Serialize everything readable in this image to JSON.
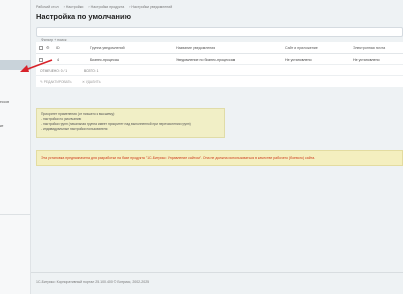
{
  "sidebar": {
    "items": [
      "ессов",
      "ке"
    ]
  },
  "breadcrumb": [
    "Рабочий стол",
    "Настройки",
    "Настройки продукта",
    "Настройки уведомлений"
  ],
  "page_title": "Настройка по умолчанию",
  "search": {
    "placeholder": "Фильтр + поиск"
  },
  "grid": {
    "columns": [
      "ID",
      "Группа уведомлений",
      "Название уведомления",
      "Сайт и приложение",
      "Электронная почта"
    ],
    "rows": [
      {
        "id": "4",
        "group": "Бизнес-процессы",
        "name": "Уведомление по бизнес-процессам",
        "site": "Не установлено",
        "email": "Не установлено"
      }
    ],
    "footer": {
      "selected": "ОТМЕЧЕНО: 0 / 1",
      "total": "ВСЕГО: 1"
    },
    "actions": {
      "edit": "РЕДАКТИРОВАТЬ",
      "delete": "УДАЛИТЬ"
    }
  },
  "info": {
    "lines": [
      "Приоритет применения (от низшего к высшему):",
      "- настройки по умолчанию",
      "- настройки групп (начальная группа имеет приоритет над выполненной при перечислении групп)",
      "- индивидуальные настройки пользователя"
    ]
  },
  "warning": "Эта установка предназначена для разработки на базе продукта \"1С-Битрикс: Управление сайтом\". Она не должна использоваться в качестве рабочего (боевого) сайта.",
  "footer": {
    "copyright": "1С-Битрикс: Корпоративный портал 25.100.400 © Битрикс, 2002-2025"
  },
  "colors": {
    "background": "#eef2f4",
    "info": "#f1efc6",
    "warning_text": "#cc3a1a",
    "arrow": "#d8232a"
  }
}
